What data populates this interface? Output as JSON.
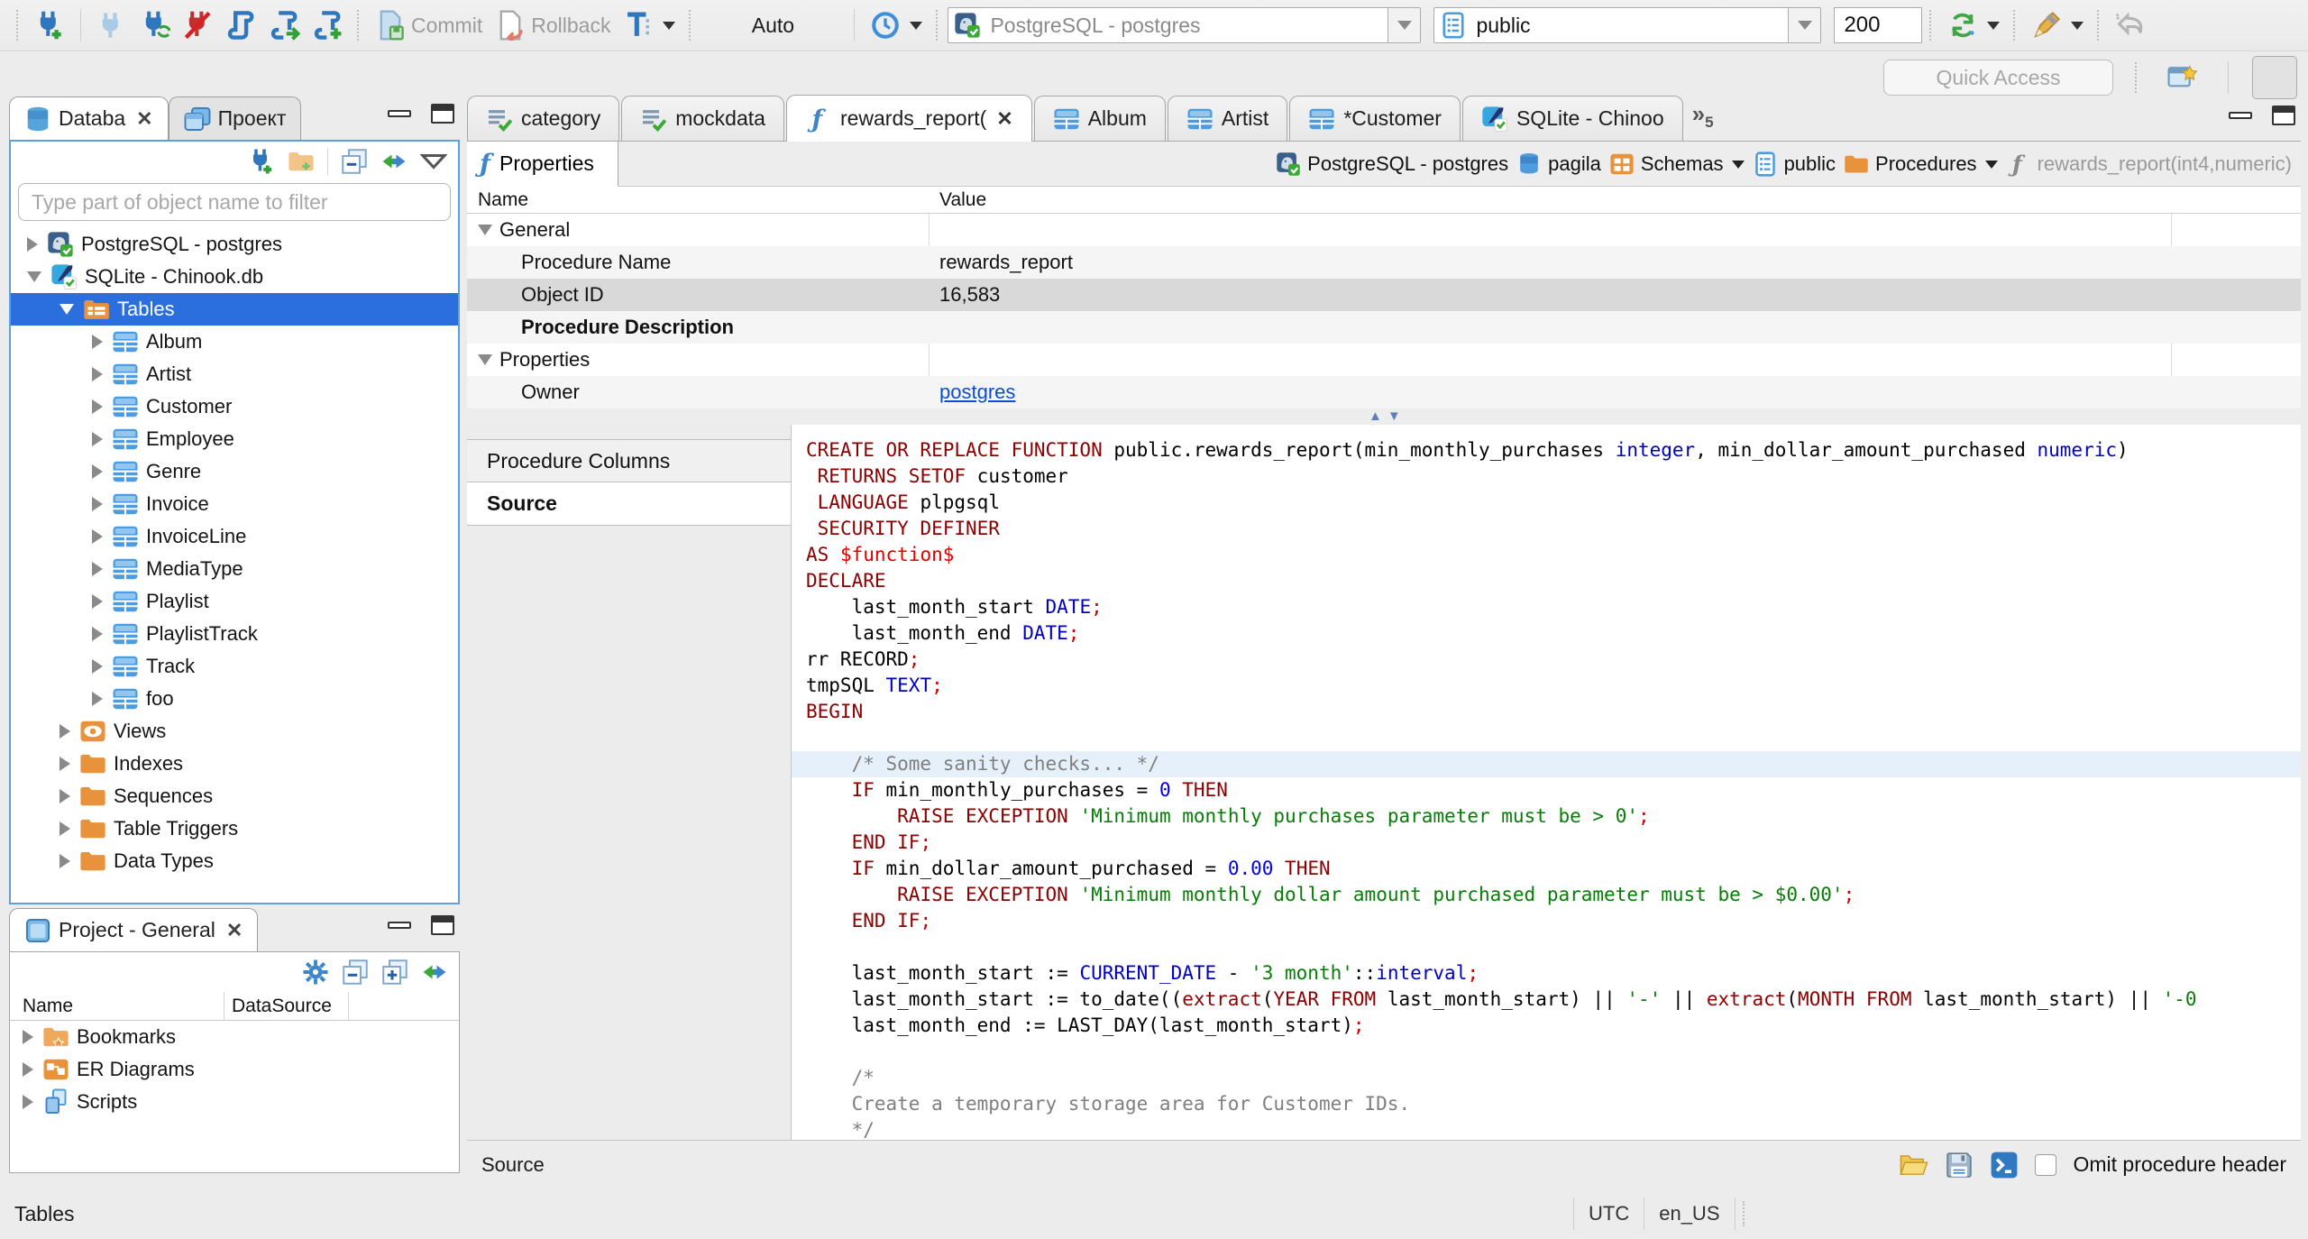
{
  "toolbar": {
    "commit": "Commit",
    "rollback": "Rollback",
    "auto": "Auto",
    "connection": "PostgreSQL - postgres",
    "schema": "public",
    "fetch_size": "200",
    "quick_access": "Quick Access"
  },
  "navigator": {
    "tab": "Databa",
    "tab2": "Проект",
    "filter_placeholder": "Type part of object name to filter",
    "tree": [
      {
        "label": "PostgreSQL - postgres",
        "icon": "postgres",
        "level": 0,
        "exp": "closed"
      },
      {
        "label": "SQLite - Chinook.db",
        "icon": "sqlite",
        "level": 0,
        "exp": "open"
      },
      {
        "label": "Tables",
        "icon": "tables-folder",
        "level": 1,
        "exp": "open",
        "selected": true
      },
      {
        "label": "Album",
        "icon": "table",
        "level": 2,
        "exp": "closed"
      },
      {
        "label": "Artist",
        "icon": "table",
        "level": 2,
        "exp": "closed"
      },
      {
        "label": "Customer",
        "icon": "table",
        "level": 2,
        "exp": "closed"
      },
      {
        "label": "Employee",
        "icon": "table",
        "level": 2,
        "exp": "closed"
      },
      {
        "label": "Genre",
        "icon": "table",
        "level": 2,
        "exp": "closed"
      },
      {
        "label": "Invoice",
        "icon": "table",
        "level": 2,
        "exp": "closed"
      },
      {
        "label": "InvoiceLine",
        "icon": "table",
        "level": 2,
        "exp": "closed"
      },
      {
        "label": "MediaType",
        "icon": "table",
        "level": 2,
        "exp": "closed"
      },
      {
        "label": "Playlist",
        "icon": "table",
        "level": 2,
        "exp": "closed"
      },
      {
        "label": "PlaylistTrack",
        "icon": "table",
        "level": 2,
        "exp": "closed"
      },
      {
        "label": "Track",
        "icon": "table",
        "level": 2,
        "exp": "closed"
      },
      {
        "label": "foo",
        "icon": "table",
        "level": 2,
        "exp": "closed"
      },
      {
        "label": "Views",
        "icon": "views",
        "level": 1,
        "exp": "closed"
      },
      {
        "label": "Indexes",
        "icon": "folder",
        "level": 1,
        "exp": "closed"
      },
      {
        "label": "Sequences",
        "icon": "folder",
        "level": 1,
        "exp": "closed"
      },
      {
        "label": "Table Triggers",
        "icon": "folder",
        "level": 1,
        "exp": "closed"
      },
      {
        "label": "Data Types",
        "icon": "folder",
        "level": 1,
        "exp": "closed"
      }
    ]
  },
  "project": {
    "tab": "Project - General",
    "columns": [
      "Name",
      "DataSource"
    ],
    "items": [
      {
        "label": "Bookmarks",
        "icon": "bookmarks"
      },
      {
        "label": "ER Diagrams",
        "icon": "er-diagram"
      },
      {
        "label": "Scripts",
        "icon": "scripts"
      }
    ]
  },
  "editor": {
    "tabs": [
      {
        "label": "category",
        "icon": "mockdata"
      },
      {
        "label": "mockdata",
        "icon": "mockdata"
      },
      {
        "label": "rewards_report(",
        "icon": "function",
        "active": true,
        "closable": true
      },
      {
        "label": "Album",
        "icon": "table"
      },
      {
        "label": "Artist",
        "icon": "table"
      },
      {
        "label": "*Customer",
        "icon": "table"
      },
      {
        "label": "SQLite - Chinoo",
        "icon": "sqlite"
      }
    ],
    "overflow_count": "5",
    "properties_tab": "Properties",
    "breadcrumb": [
      {
        "label": "PostgreSQL - postgres",
        "icon": "postgres"
      },
      {
        "label": "pagila",
        "icon": "database"
      },
      {
        "label": "Schemas",
        "icon": "schemas",
        "dropdown": true
      },
      {
        "label": "public",
        "icon": "schema-card"
      },
      {
        "label": "Procedures",
        "icon": "folder",
        "dropdown": true
      },
      {
        "label": "rewards_report(int4,numeric)",
        "icon": "function-gray",
        "muted": true
      }
    ],
    "grid": {
      "columns": [
        "Name",
        "Value"
      ],
      "rows": [
        {
          "name": "General",
          "type": "group",
          "value": ""
        },
        {
          "name": "Procedure Name",
          "value": "rewards_report"
        },
        {
          "name": "Object ID",
          "value": "16,583",
          "selected": true
        },
        {
          "name": "Procedure Description",
          "bold": true,
          "value": ""
        },
        {
          "name": "Properties",
          "type": "group",
          "value": ""
        },
        {
          "name": "Owner",
          "value": "postgres",
          "link": true
        }
      ]
    },
    "side_tabs": [
      {
        "label": "Procedure Columns",
        "icon": "function-gray"
      },
      {
        "label": "Source",
        "icon": "source",
        "active": true
      }
    ],
    "bottom": {
      "label": "Source",
      "omit_label": "Omit procedure header"
    }
  },
  "code": {
    "lines": [
      {
        "hl": false,
        "toks": [
          [
            "k",
            "CREATE OR REPLACE FUNCTION"
          ],
          [
            "d",
            " public.rewards_report(min_monthly_purchases "
          ],
          [
            "t",
            "integer"
          ],
          [
            "d",
            ", min_dollar_amount_purchased "
          ],
          [
            "t",
            "numeric"
          ],
          [
            "d",
            ")"
          ]
        ]
      },
      {
        "hl": false,
        "toks": [
          [
            "d",
            " "
          ],
          [
            "k",
            "RETURNS SETOF"
          ],
          [
            "d",
            " customer"
          ]
        ]
      },
      {
        "hl": false,
        "toks": [
          [
            "d",
            " "
          ],
          [
            "k",
            "LANGUAGE"
          ],
          [
            "d",
            " plpgsql"
          ]
        ]
      },
      {
        "hl": false,
        "toks": [
          [
            "d",
            " "
          ],
          [
            "k",
            "SECURITY DEFINER"
          ]
        ]
      },
      {
        "hl": false,
        "toks": [
          [
            "k",
            "AS"
          ],
          [
            "d",
            " "
          ],
          [
            "r",
            "$function$"
          ]
        ]
      },
      {
        "hl": false,
        "toks": [
          [
            "k",
            "DECLARE"
          ]
        ]
      },
      {
        "hl": false,
        "toks": [
          [
            "d",
            "    last_month_start "
          ],
          [
            "t",
            "DATE"
          ],
          [
            "p",
            ";"
          ]
        ]
      },
      {
        "hl": false,
        "toks": [
          [
            "d",
            "    last_month_end "
          ],
          [
            "t",
            "DATE"
          ],
          [
            "p",
            ";"
          ]
        ]
      },
      {
        "hl": false,
        "toks": [
          [
            "d",
            "rr RECORD"
          ],
          [
            "p",
            ";"
          ]
        ]
      },
      {
        "hl": false,
        "toks": [
          [
            "d",
            "tmpSQL "
          ],
          [
            "t",
            "TEXT"
          ],
          [
            "p",
            ";"
          ]
        ]
      },
      {
        "hl": false,
        "toks": [
          [
            "k",
            "BEGIN"
          ]
        ]
      },
      {
        "hl": false,
        "toks": []
      },
      {
        "hl": true,
        "toks": [
          [
            "c",
            "    /* Some sanity checks... */"
          ]
        ]
      },
      {
        "hl": false,
        "toks": [
          [
            "d",
            "    "
          ],
          [
            "k",
            "IF"
          ],
          [
            "d",
            " min_monthly_purchases = "
          ],
          [
            "n",
            "0"
          ],
          [
            "d",
            " "
          ],
          [
            "k",
            "THEN"
          ]
        ]
      },
      {
        "hl": false,
        "toks": [
          [
            "d",
            "        "
          ],
          [
            "k",
            "RAISE EXCEPTION"
          ],
          [
            "d",
            " "
          ],
          [
            "s",
            "'Minimum monthly purchases parameter must be > 0'"
          ],
          [
            "p",
            ";"
          ]
        ]
      },
      {
        "hl": false,
        "toks": [
          [
            "d",
            "    "
          ],
          [
            "k",
            "END IF"
          ],
          [
            "p",
            ";"
          ]
        ]
      },
      {
        "hl": false,
        "toks": [
          [
            "d",
            "    "
          ],
          [
            "k",
            "IF"
          ],
          [
            "d",
            " min_dollar_amount_purchased = "
          ],
          [
            "n",
            "0.00"
          ],
          [
            "d",
            " "
          ],
          [
            "k",
            "THEN"
          ]
        ]
      },
      {
        "hl": false,
        "toks": [
          [
            "d",
            "        "
          ],
          [
            "k",
            "RAISE EXCEPTION"
          ],
          [
            "d",
            " "
          ],
          [
            "s",
            "'Minimum monthly dollar amount purchased parameter must be > $0.00'"
          ],
          [
            "p",
            ";"
          ]
        ]
      },
      {
        "hl": false,
        "toks": [
          [
            "d",
            "    "
          ],
          [
            "k",
            "END IF"
          ],
          [
            "p",
            ";"
          ]
        ]
      },
      {
        "hl": false,
        "toks": []
      },
      {
        "hl": false,
        "toks": [
          [
            "d",
            "    last_month_start := "
          ],
          [
            "t",
            "CURRENT_DATE"
          ],
          [
            "d",
            " - "
          ],
          [
            "s",
            "'3 month'"
          ],
          [
            "d",
            "::"
          ],
          [
            "t",
            "interval"
          ],
          [
            "p",
            ";"
          ]
        ]
      },
      {
        "hl": false,
        "toks": [
          [
            "d",
            "    last_month_start := to_date(("
          ],
          [
            "k",
            "extract"
          ],
          [
            "d",
            "("
          ],
          [
            "k",
            "YEAR FROM"
          ],
          [
            "d",
            " last_month_start) || "
          ],
          [
            "s",
            "'-'"
          ],
          [
            "d",
            " || "
          ],
          [
            "k",
            "extract"
          ],
          [
            "d",
            "("
          ],
          [
            "k",
            "MONTH FROM"
          ],
          [
            "d",
            " last_month_start) || "
          ],
          [
            "s",
            "'-0"
          ]
        ]
      },
      {
        "hl": false,
        "toks": [
          [
            "d",
            "    last_month_end := LAST_DAY(last_month_start)"
          ],
          [
            "p",
            ";"
          ]
        ]
      },
      {
        "hl": false,
        "toks": []
      },
      {
        "hl": false,
        "toks": [
          [
            "c",
            "    /*"
          ]
        ]
      },
      {
        "hl": false,
        "toks": [
          [
            "c",
            "    Create a temporary storage area for Customer IDs."
          ]
        ]
      },
      {
        "hl": false,
        "toks": [
          [
            "c",
            "    */"
          ]
        ]
      }
    ]
  },
  "status": {
    "left": "Tables",
    "tz": "UTC",
    "locale": "en_US"
  }
}
